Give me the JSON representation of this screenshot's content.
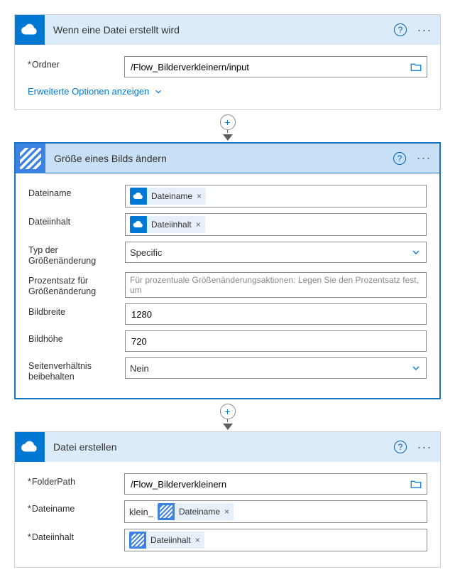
{
  "card1": {
    "title": "Wenn eine Datei erstellt wird",
    "folder_label": "Ordner",
    "folder_value": "/Flow_Bilderverkleinern/input",
    "advanced": "Erweiterte Optionen anzeigen"
  },
  "card2": {
    "title": "Größe eines Bilds ändern",
    "filename_label": "Dateiname",
    "filename_token": "Dateiname",
    "filecontent_label": "Dateiinhalt",
    "filecontent_token": "Dateiinhalt",
    "resizetype_label": "Typ der Größenänderung",
    "resizetype_value": "Specific",
    "percent_label": "Prozentsatz für Größenänderung",
    "percent_placeholder": "Für prozentuale Größenänderungsaktionen: Legen Sie den Prozentsatz fest, um",
    "width_label": "Bildbreite",
    "width_value": "1280",
    "height_label": "Bildhöhe",
    "height_value": "720",
    "aspect_label": "Seitenverhältnis beibehalten",
    "aspect_value": "Nein"
  },
  "card3": {
    "title": "Datei erstellen",
    "folderpath_label": "FolderPath",
    "folderpath_value": "/Flow_Bilderverkleinern",
    "filename_label": "Dateiname",
    "filename_prefix": "klein_",
    "filename_token": "Dateiname",
    "filecontent_label": "Dateiinhalt",
    "filecontent_token": "Dateiinhalt"
  }
}
